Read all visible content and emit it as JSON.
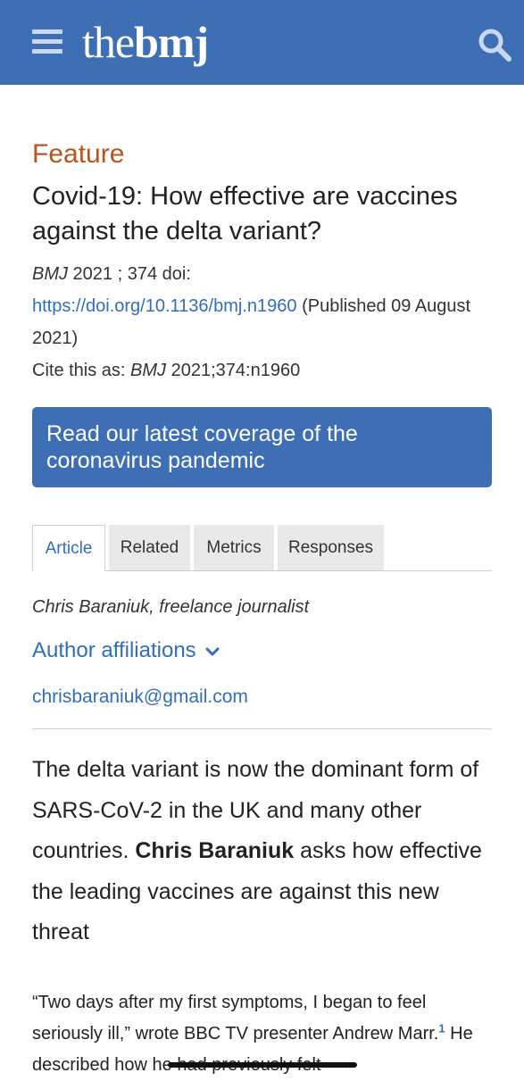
{
  "header": {
    "logo_thin": "the",
    "logo_bold": "bmj",
    "brand_color": "#3e6fb5"
  },
  "article": {
    "section": "Feature",
    "title": "Covid-19: How effective are vaccines against the delta variant?",
    "journal": "BMJ",
    "year_volume": " 2021 ; 374  doi:",
    "doi_url": "https://doi.org/10.1136/bmj.n1960",
    "published": " (Published 09 August 2021)",
    "cite_prefix": "Cite this as: ",
    "cite_journal": "BMJ",
    "cite_ref": " 2021;374:n1960"
  },
  "banner": {
    "text": "Read our latest coverage of the coronavirus pandemic"
  },
  "tabs": [
    {
      "label": "Article",
      "active": true
    },
    {
      "label": "Related",
      "active": false
    },
    {
      "label": "Metrics",
      "active": false
    },
    {
      "label": "Responses",
      "active": false
    }
  ],
  "author": {
    "byline": "Chris Baraniuk, freelance journalist",
    "affiliations_label": "Author affiliations",
    "email": "chrisbaraniuk@gmail.com"
  },
  "standfirst": {
    "before": "The delta variant is now the dominant form of SARS-CoV-2 in the UK and many other countries. ",
    "name": "Chris Baraniuk",
    "after": " asks how effective the leading vaccines are against this new threat"
  },
  "body": {
    "para1": "“Two days after my first symptoms, I began to feel seriously ill,” wrote BBC TV presenter Andrew Marr.",
    "ref1": "1",
    "para1_cont": " He described how he had previously felt"
  },
  "icons": {
    "menu": "hamburger-menu-icon",
    "search": "search-icon",
    "chevron": "chevron-down-icon"
  }
}
